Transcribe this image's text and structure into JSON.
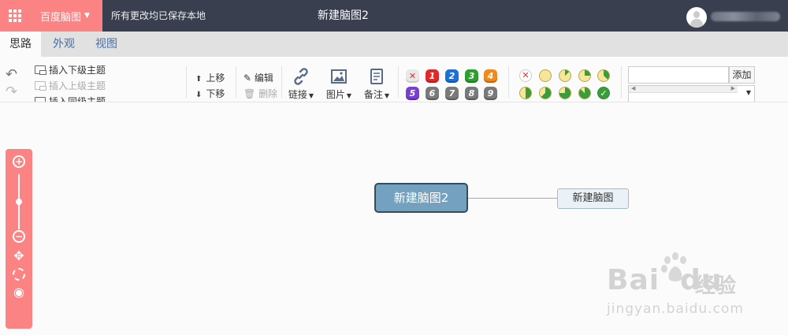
{
  "topbar": {
    "apps_icon": "grid-apps-icon",
    "brand": "百度脑图",
    "save_status": "所有更改均已保存本地",
    "document_title": "新建脑图2",
    "brand_color": "#fc8383",
    "bar_color": "#393f4f"
  },
  "tabs": [
    {
      "label": "思路",
      "active": true
    },
    {
      "label": "外观",
      "active": false
    },
    {
      "label": "视图",
      "active": false
    }
  ],
  "ribbon": {
    "insert": {
      "child": "插入下级主题",
      "parent": "插入上级主题",
      "sibling": "插入同级主题"
    },
    "move": {
      "up": "上移",
      "down": "下移"
    },
    "edit": {
      "edit": "编辑",
      "delete": "删除"
    },
    "link": "链接",
    "image": "图片",
    "note": "备注",
    "priorities": [
      {
        "label": "✕",
        "color": "#e8e8e8"
      },
      {
        "label": "1",
        "color": "#e02a2a"
      },
      {
        "label": "2",
        "color": "#1e6fd8"
      },
      {
        "label": "3",
        "color": "#2e9e2e"
      },
      {
        "label": "4",
        "color": "#f08a1c"
      },
      {
        "label": "5",
        "color": "#7a3fd1"
      },
      {
        "label": "6",
        "color": "#7a7a7a"
      },
      {
        "label": "7",
        "color": "#7a7a7a"
      },
      {
        "label": "8",
        "color": "#7a7a7a"
      },
      {
        "label": "9",
        "color": "#7a7a7a"
      }
    ],
    "progress": [
      {
        "value": "clear"
      },
      {
        "value": 0
      },
      {
        "value": 0.125
      },
      {
        "value": 0.25
      },
      {
        "value": 0.375
      },
      {
        "value": 0.5
      },
      {
        "value": 0.625
      },
      {
        "value": 0.75
      },
      {
        "value": 0.875
      },
      {
        "value": 1
      }
    ],
    "resource": {
      "add": "添加",
      "input_value": ""
    }
  },
  "canvas": {
    "root_node": "新建脑图2",
    "child_node": "新建脑图",
    "zoom_controls": [
      "zoom-in-icon",
      "zoom-out-icon",
      "move-icon",
      "locate-icon",
      "eye-icon"
    ]
  },
  "watermark": {
    "main": "Bai",
    "main_tail": "du",
    "cn": "经验",
    "sub": "jingyan.baidu.com"
  }
}
